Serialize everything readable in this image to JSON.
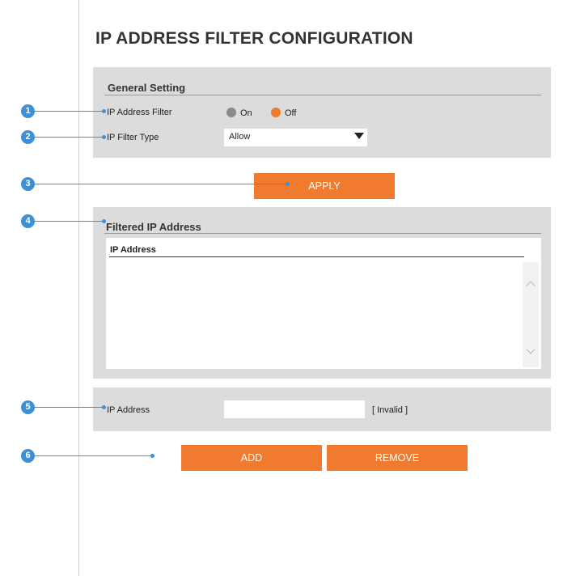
{
  "page": {
    "title": "IP ADDRESS FILTER CONFIGURATION"
  },
  "general": {
    "title": "General Setting",
    "ip_filter_label": "IP Address Filter",
    "on_label": "On",
    "off_label": "Off",
    "selected": "Off",
    "filter_type_label": "IP Filter Type",
    "filter_type_value": "Allow"
  },
  "apply_label": "APPLY",
  "filtered": {
    "title": "Filtered IP Address",
    "column_header": "IP Address",
    "rows": []
  },
  "entry": {
    "label": "IP Address",
    "value": "",
    "status": "[ Invalid ]"
  },
  "add_label": "ADD",
  "remove_label": "REMOVE",
  "markers": [
    "1",
    "2",
    "3",
    "4",
    "5",
    "6"
  ],
  "colors": {
    "accent": "#f07a2e",
    "marker": "#3e8fd4",
    "panel": "#dcdcdc"
  }
}
